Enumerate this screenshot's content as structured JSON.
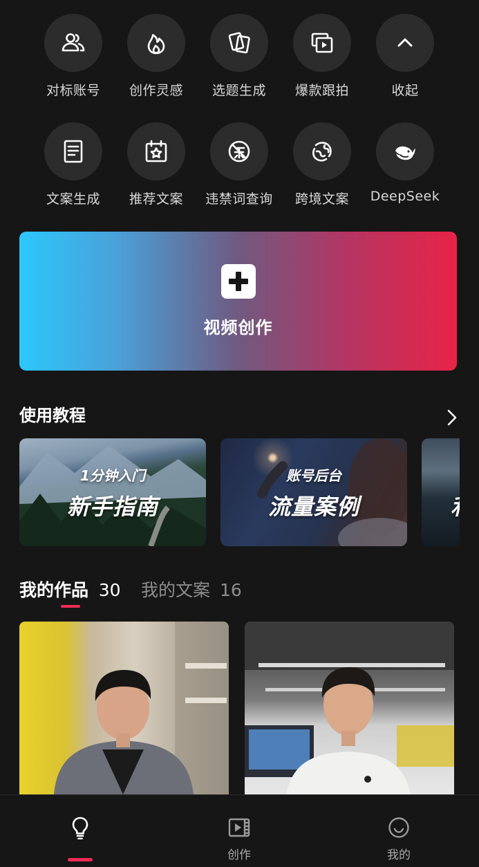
{
  "tools": {
    "row1": [
      {
        "label": "对标账号",
        "icon": "users-icon"
      },
      {
        "label": "创作灵感",
        "icon": "flame-icon"
      },
      {
        "label": "选题生成",
        "icon": "cards-icon"
      },
      {
        "label": "爆款跟拍",
        "icon": "video-copy-icon"
      },
      {
        "label": "收起",
        "icon": "chevron-up-icon"
      }
    ],
    "row2": [
      {
        "label": "文案生成",
        "icon": "document-icon"
      },
      {
        "label": "推荐文案",
        "icon": "calendar-star-icon"
      },
      {
        "label": "违禁词查询",
        "icon": "forbidden-icon"
      },
      {
        "label": "跨境文案",
        "icon": "globe-icon"
      },
      {
        "label": "DeepSeek",
        "icon": "whale-icon"
      }
    ]
  },
  "create_banner": {
    "label": "视频创作",
    "icon": "plus-icon"
  },
  "tutorials": {
    "title": "使用教程",
    "cards": [
      {
        "small": "1分钟入门",
        "big": "新手指南"
      },
      {
        "small": "账号后台",
        "big": "流量案例"
      },
      {
        "small": "",
        "big": "利"
      }
    ]
  },
  "works_tabs": {
    "active": {
      "label": "我的作品",
      "count": "30"
    },
    "inactive": {
      "label": "我的文案",
      "count": "16"
    }
  },
  "bottom_nav": {
    "items": [
      {
        "label": "",
        "icon": "lightbulb-icon",
        "active": true
      },
      {
        "label": "创作",
        "icon": "film-icon",
        "active": false
      },
      {
        "label": "我的",
        "icon": "smile-icon",
        "active": false
      }
    ]
  },
  "colors": {
    "accent": "#ee2c55",
    "background": "#161616",
    "banner_start": "#2bc8fb",
    "banner_end": "#e82347"
  }
}
